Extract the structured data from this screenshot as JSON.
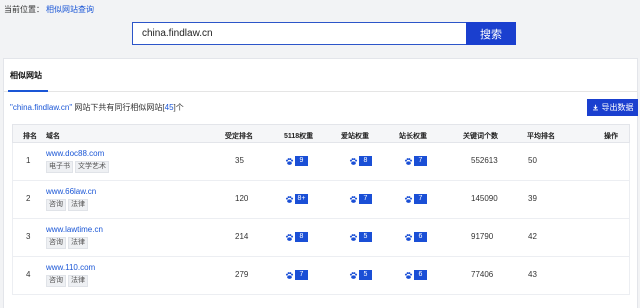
{
  "breadcrumb": {
    "label": "当前位置：",
    "link": "相似网站查询"
  },
  "search": {
    "value": "china.findlaw.cn",
    "button_label": "搜索"
  },
  "tab": {
    "label": "相似网站"
  },
  "summary": {
    "quoted_domain": "\"china.findlaw.cn\"",
    "middle": " 网站下共有同行相似网站[",
    "count": "45",
    "tail": "]个"
  },
  "export_button": {
    "label": "导出数据",
    "icon": "download-icon"
  },
  "table": {
    "headers": {
      "rank": "排名",
      "domain": "域名",
      "indexed": "受定排名",
      "weight5118": "5118权重",
      "aizhan": "爱站权重",
      "zhanzhang": "站长权重",
      "keywords": "关键词个数",
      "avg_rank": "平均排名",
      "action": "操作"
    },
    "rows": [
      {
        "rank": "1",
        "domain": "www.doc88.com",
        "tags": [
          "电子书",
          "文学艺术"
        ],
        "indexed": "35",
        "w5118": "9",
        "aizhan": "8",
        "zhanzhang": "7",
        "keywords": "552613",
        "avg_rank": "50"
      },
      {
        "rank": "2",
        "domain": "www.66law.cn",
        "tags": [
          "咨询",
          "法律"
        ],
        "indexed": "120",
        "w5118": "8+",
        "aizhan": "7",
        "zhanzhang": "7",
        "keywords": "145090",
        "avg_rank": "39"
      },
      {
        "rank": "3",
        "domain": "www.lawtime.cn",
        "tags": [
          "咨询",
          "法律"
        ],
        "indexed": "214",
        "w5118": "8",
        "aizhan": "5",
        "zhanzhang": "6",
        "keywords": "91790",
        "avg_rank": "42"
      },
      {
        "rank": "4",
        "domain": "www.110.com",
        "tags": [
          "咨询",
          "法律"
        ],
        "indexed": "279",
        "w5118": "7",
        "aizhan": "5",
        "zhanzhang": "6",
        "keywords": "77406",
        "avg_rank": "43"
      }
    ]
  },
  "colors": {
    "accent": "#1a3fcf",
    "link": "#1a56d6",
    "badge": "#1a4fd6"
  },
  "icons": {
    "badge": "paw-icon"
  }
}
